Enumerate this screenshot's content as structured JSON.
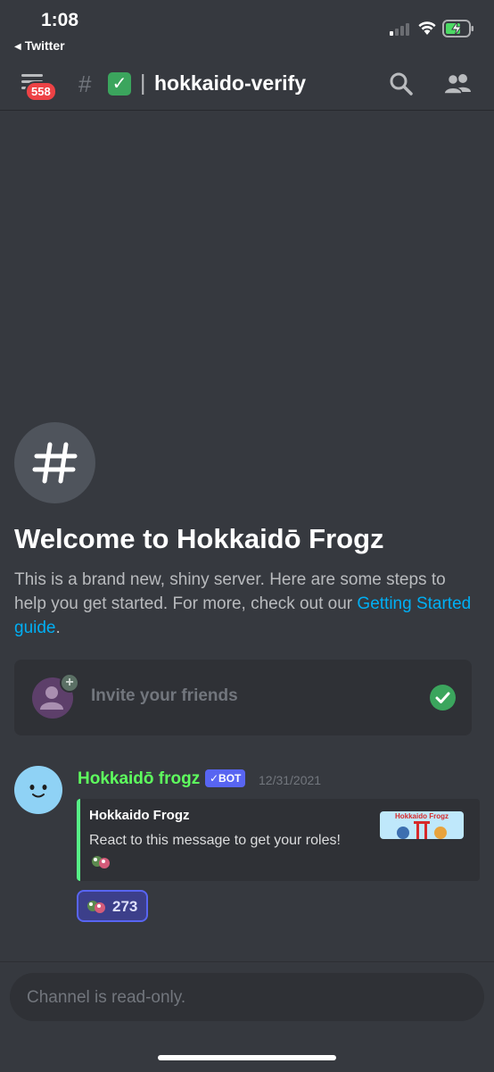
{
  "status_bar": {
    "time": "1:08",
    "back_app": "Twitter"
  },
  "header": {
    "unread_count": "558",
    "hash_symbol": "#",
    "channel_emoji": "✓",
    "separator": "|",
    "channel_name": "hokkaido-verify"
  },
  "welcome": {
    "title": "Welcome to Hokkaidō Frogz",
    "description": "This is a brand new, shiny server. Here are some steps to help you get started. For more, check out our ",
    "link_text": "Getting Started guide",
    "after_link": "."
  },
  "invite_card": {
    "label": "Invite your friends",
    "plus": "+"
  },
  "message": {
    "author": "Hokkaidō frogz",
    "bot_tag": "✓BOT",
    "timestamp": "12/31/2021",
    "embed": {
      "title": "Hokkaido Frogz",
      "description": "React to this message to get your roles!",
      "thumbnail_text": "Hokkaido Frogz"
    },
    "reaction": {
      "count": "273"
    }
  },
  "composer": {
    "placeholder": "Channel is read-only."
  },
  "colors": {
    "background": "#36393f",
    "accent_blurple": "#5865f2",
    "author_green": "#5eff5e",
    "success_green": "#3ba55d",
    "link_blue": "#00aff4",
    "badge_red": "#ed4245"
  },
  "icons": [
    "hamburger-menu-icon",
    "search-icon",
    "members-icon",
    "hash-icon",
    "add-friend-icon",
    "checkmark-icon",
    "frog-emoji-icon",
    "bot-avatar-icon"
  ]
}
